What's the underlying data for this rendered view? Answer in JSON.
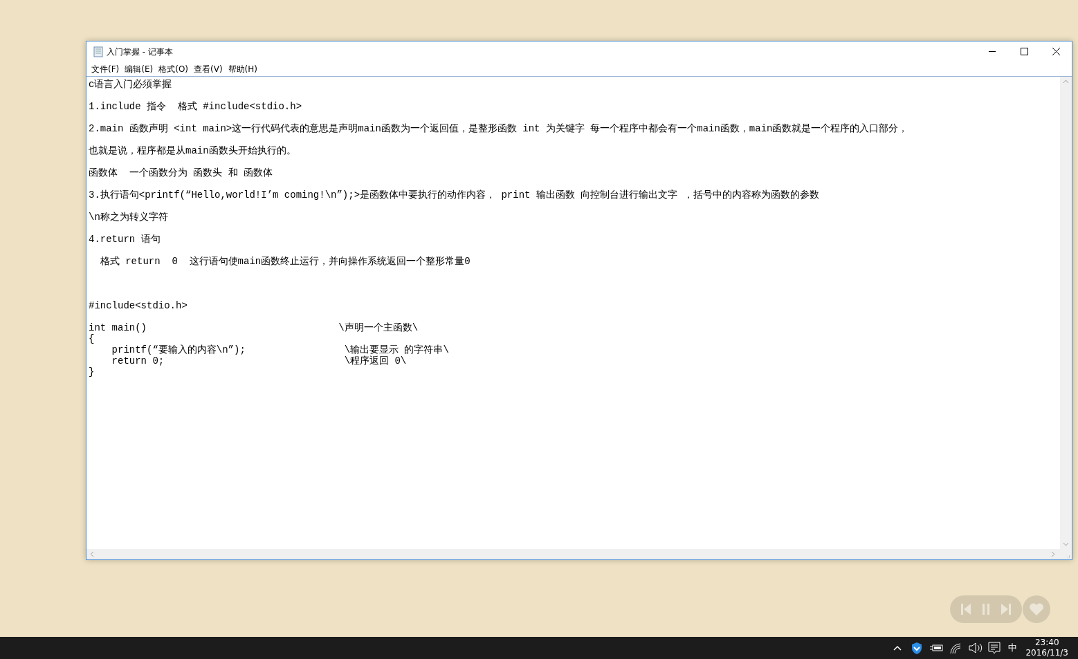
{
  "window": {
    "title": "入门掌握 - 记事本",
    "menu": [
      "文件(F)",
      "编辑(E)",
      "格式(O)",
      "查看(V)",
      "帮助(H)"
    ]
  },
  "document": {
    "sections": [
      {
        "paragraphs": [
          [
            "c语言入门必须掌握"
          ],
          [
            "1.include 指令  格式 #include<stdio.h>"
          ],
          [
            "2.main 函数声明 <int main>这一行代码代表的意思是声明main函数为一个返回值，是整形函数 int 为关键字 每一个程序中都会有一个main函数，main函数就是一个程序的入口部分，"
          ],
          [
            "也就是说，程序都是从main函数头开始执行的。"
          ],
          [
            "函数体  一个函数分为 函数头 和 函数体"
          ],
          [
            "3.执行语句<printf(“Hello,world!I’m coming!\\n”);>是函数体中要执行的动作内容， print 输出函数 向控制台进行输出文字 ，括号中的内容称为函数的参数"
          ],
          [
            "\\n称之为转义字符"
          ],
          [
            "4.return 语句"
          ],
          [
            "  格式 return  0  这行语句使main函数终止运行，并向操作系统返回一个整形常量0"
          ]
        ]
      },
      {
        "paragraphs": [
          [
            "#include<stdio.h>"
          ],
          [
            "int main()                                 \\声明一个主函数\\",
            "{",
            "    printf(“要输入的内容\\n”);                 \\输出要显示 的字符串\\",
            "    return 0;                               \\程序返回 0\\",
            "}"
          ]
        ]
      }
    ]
  },
  "taskbar": {
    "input_method": "中",
    "time": "23:40",
    "date": "2016/11/3"
  }
}
